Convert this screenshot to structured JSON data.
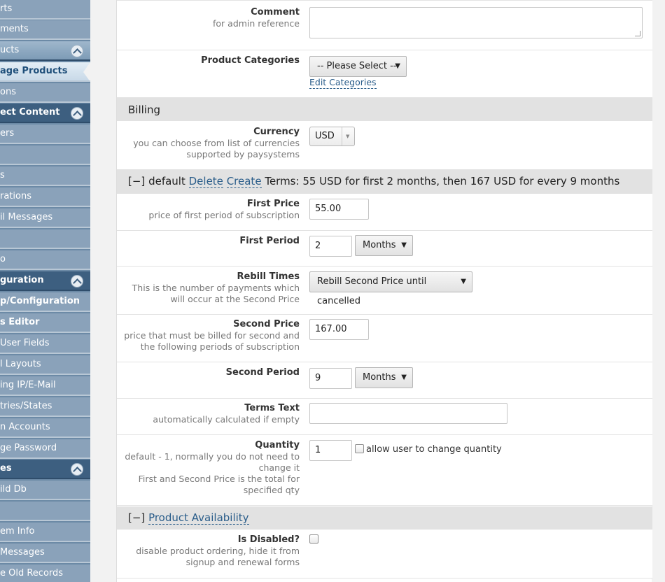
{
  "sidebar": {
    "items": [
      {
        "label": "rts"
      },
      {
        "label": "ments"
      },
      {
        "label": "ucts"
      },
      {
        "label": "age Products"
      },
      {
        "label": "ons"
      },
      {
        "label": "ect Content"
      },
      {
        "label": "ers"
      },
      {
        "label": ""
      },
      {
        "label": "s"
      },
      {
        "label": "rations"
      },
      {
        "label": "il Messages"
      },
      {
        "label": ""
      },
      {
        "label": "o"
      },
      {
        "label": "guration"
      },
      {
        "label": "p/Configuration"
      },
      {
        "label": "s Editor"
      },
      {
        "label": "User Fields"
      },
      {
        "label": "l Layouts"
      },
      {
        "label": "ing IP/E-Mail"
      },
      {
        "label": "tries/States"
      },
      {
        "label": "n Accounts"
      },
      {
        "label": "ge Password"
      },
      {
        "label": "es"
      },
      {
        "label": "ild Db"
      },
      {
        "label": ""
      },
      {
        "label": "em Info"
      },
      {
        "label": "Messages"
      },
      {
        "label": "e Old Records"
      }
    ]
  },
  "form": {
    "comment": {
      "title": "Comment",
      "desc": "for admin reference",
      "value": ""
    },
    "categories": {
      "title": "Product Categories",
      "value": "-- Please Select --",
      "edit_link": "Edit Categories"
    },
    "billing_header": "Billing",
    "currency": {
      "title": "Currency",
      "desc1": "you can choose from list of currencies",
      "desc2": "supported by paysystems",
      "value": "USD"
    },
    "plan_header": {
      "toggle": "[−]",
      "name": "default",
      "delete": "Delete",
      "create": "Create",
      "terms": "Terms: 55 USD for first 2 months, then 167 USD for every 9 months"
    },
    "first_price": {
      "title": "First Price",
      "desc": "price of first period of subscription",
      "value": "55.00"
    },
    "first_period": {
      "title": "First Period",
      "value": "2",
      "unit": "Months"
    },
    "rebill_times": {
      "title": "Rebill Times",
      "desc1": "This is the number of payments which",
      "desc2": "will occur at the Second Price",
      "value": "Rebill Second Price until cancelled"
    },
    "second_price": {
      "title": "Second Price",
      "desc1": "price that must be billed for second and",
      "desc2": "the following periods of subscription",
      "value": "167.00"
    },
    "second_period": {
      "title": "Second Period",
      "value": "9",
      "unit": "Months"
    },
    "terms_text": {
      "title": "Terms Text",
      "desc": "automatically calculated if empty",
      "value": ""
    },
    "quantity": {
      "title": "Quantity",
      "desc1": "default - 1, normally you do not need to",
      "desc2": "change it",
      "desc3": "First and Second Price is the total for",
      "desc4": "specified qty",
      "value": "1",
      "allow_label": "allow user to change quantity"
    },
    "availability_header": {
      "toggle": "[−]",
      "label": "Product Availability"
    },
    "is_disabled": {
      "title": "Is Disabled?",
      "desc1": "disable product ordering, hide it from",
      "desc2": "signup and renewal forms"
    }
  },
  "colors": {
    "sidebar_bg": "#6c8aa6",
    "sidebar_header": "#3d5f80",
    "link": "#2a5d8a",
    "section_bg": "#e2e2e2"
  }
}
